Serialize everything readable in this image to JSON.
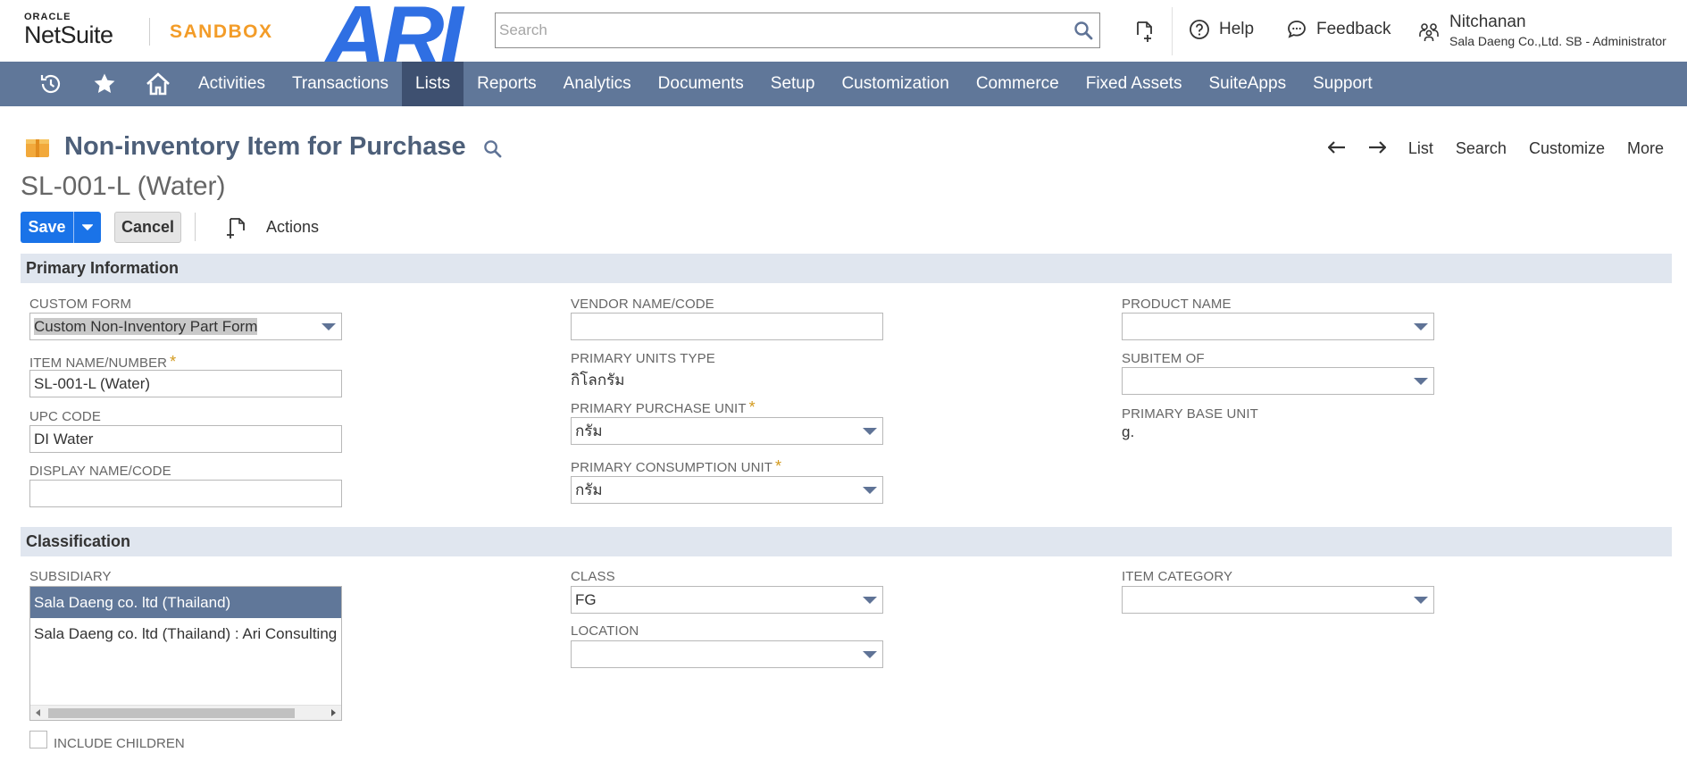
{
  "header": {
    "oracle_text": "ORACLE",
    "netsuite_text": "NetSuite",
    "sandbox_text": "SANDBOX",
    "ari_logo_text": "ARI",
    "search_placeholder": "Search",
    "help_label": "Help",
    "feedback_label": "Feedback",
    "user_name": "Nitchanan",
    "user_role": "Sala Daeng Co.,Ltd. SB - Administrator"
  },
  "navbar": {
    "items": [
      {
        "label": "Activities"
      },
      {
        "label": "Transactions"
      },
      {
        "label": "Lists",
        "active": true
      },
      {
        "label": "Reports"
      },
      {
        "label": "Analytics"
      },
      {
        "label": "Documents"
      },
      {
        "label": "Setup"
      },
      {
        "label": "Customization"
      },
      {
        "label": "Commerce"
      },
      {
        "label": "Fixed Assets"
      },
      {
        "label": "SuiteApps"
      },
      {
        "label": "Support"
      }
    ]
  },
  "page": {
    "title": "Non-inventory Item for Purchase",
    "record_name": "SL-001-L (Water)",
    "nav": {
      "list": "List",
      "search": "Search",
      "customize": "Customize",
      "more": "More"
    }
  },
  "buttons": {
    "save": "Save",
    "cancel": "Cancel",
    "actions": "Actions"
  },
  "primary_info": {
    "section_title": "Primary Information",
    "custom_form": {
      "label": "CUSTOM FORM",
      "value": "Custom Non-Inventory Part Form"
    },
    "item_name": {
      "label": "ITEM NAME/NUMBER",
      "value": "SL-001-L (Water)",
      "required": "*"
    },
    "upc_code": {
      "label": "UPC CODE",
      "value": "DI Water"
    },
    "display_name": {
      "label": "DISPLAY NAME/CODE",
      "value": ""
    },
    "vendor_name": {
      "label": "VENDOR NAME/CODE",
      "value": ""
    },
    "primary_units_type": {
      "label": "PRIMARY UNITS TYPE",
      "value": "กิโลกรัม"
    },
    "primary_purchase_unit": {
      "label": "PRIMARY PURCHASE UNIT",
      "value": "กรัม",
      "required": "*"
    },
    "primary_consumption_unit": {
      "label": "PRIMARY CONSUMPTION UNIT",
      "value": "กรัม",
      "required": "*"
    },
    "product_name": {
      "label": "PRODUCT NAME",
      "value": ""
    },
    "subitem_of": {
      "label": "SUBITEM OF",
      "value": ""
    },
    "primary_base_unit": {
      "label": "PRIMARY BASE UNIT",
      "value": "g."
    }
  },
  "classification": {
    "section_title": "Classification",
    "subsidiary": {
      "label": "SUBSIDIARY",
      "options": [
        {
          "label": "Sala Daeng co. ltd (Thailand)",
          "selected": true
        },
        {
          "label": "Sala Daeng co. ltd (Thailand) : Ari Consulting co. ltd",
          "selected": false
        }
      ]
    },
    "include_children": {
      "label": "INCLUDE CHILDREN",
      "checked": false
    },
    "class": {
      "label": "CLASS",
      "value": "FG"
    },
    "location": {
      "label": "LOCATION",
      "value": ""
    },
    "item_category": {
      "label": "ITEM CATEGORY",
      "value": ""
    }
  },
  "colors": {
    "navbar_bg": "#607799",
    "navbar_active": "#3e5070",
    "save_button": "#1a73e8",
    "sandbox_orange": "#f39c28",
    "ari_blue": "#2f6fe3",
    "section_bg": "#e0e6ef",
    "required_star": "#d39a1e"
  }
}
